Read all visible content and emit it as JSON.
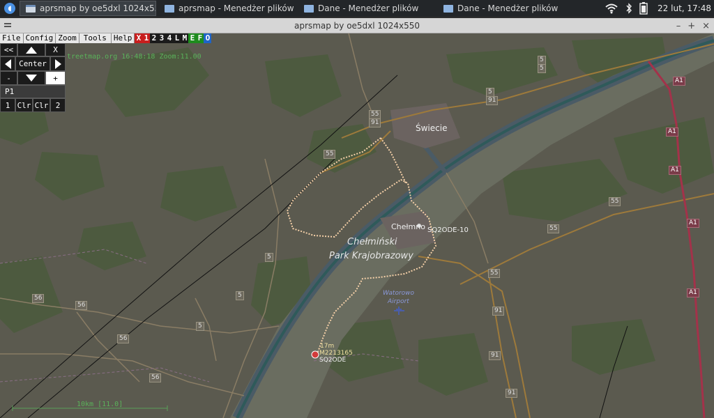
{
  "taskbar": {
    "tasks": [
      {
        "label": "aprsmap by oe5dxl 1024x550",
        "active": true
      },
      {
        "label": "aprsmap - Menedżer plików",
        "active": false
      },
      {
        "label": "Dane - Menedżer plików",
        "active": false
      },
      {
        "label": "Dane - Menedżer plików",
        "active": false
      }
    ],
    "clock": "22 lut, 17:48"
  },
  "window": {
    "title": "aprsmap by oe5dxl 1024x550",
    "buttons": [
      "–",
      "+",
      "×"
    ]
  },
  "menu": {
    "items": [
      "File",
      "Config",
      "Zoom",
      "Tools",
      "Help"
    ],
    "flags": [
      {
        "label": "X",
        "color": "#c81e1e"
      },
      {
        "label": "1",
        "color": "#c81e1e"
      },
      {
        "label": "2",
        "color": "#1b1b1b"
      },
      {
        "label": "3",
        "color": "#1b1b1b"
      },
      {
        "label": "4",
        "color": "#1b1b1b"
      },
      {
        "label": "L",
        "color": "#1b1b1b"
      },
      {
        "label": "M",
        "color": "#1b1b1b"
      },
      {
        "label": "E",
        "color": "#1e8c1e"
      },
      {
        "label": "F",
        "color": "#1e8c1e"
      },
      {
        "label": "O",
        "color": "#1e64c8"
      }
    ]
  },
  "controls": {
    "back": "<<",
    "close": "X",
    "center": "Center",
    "minus": "-",
    "plus": "+",
    "p1": "P1",
    "one": "1",
    "clr1": "Clr",
    "clr2": "Clr",
    "two": "2"
  },
  "map": {
    "status": "treetmap.org 16:48:18 Zoom:11.00",
    "scale": "10km [11.0]",
    "places": {
      "swiecie": "Świecie",
      "chelmno": "Chełmno",
      "park1": "Chełmiński",
      "park2": "Park Krajobrazowy",
      "airport1": "Watorowo",
      "airport2": "Airport"
    },
    "stations": {
      "s1": "SQ2ODE-10",
      "alt": "17m",
      "id": "M2213165",
      "s2": "SQ2ODE"
    },
    "roads": [
      "55",
      "91",
      "5",
      "91",
      "55",
      "55",
      "5",
      "5",
      "5",
      "5",
      "56",
      "56",
      "5",
      "56",
      "56",
      "55",
      "55",
      "91",
      "91",
      "91",
      "A1",
      "A1",
      "A1",
      "A1",
      "A1"
    ]
  }
}
